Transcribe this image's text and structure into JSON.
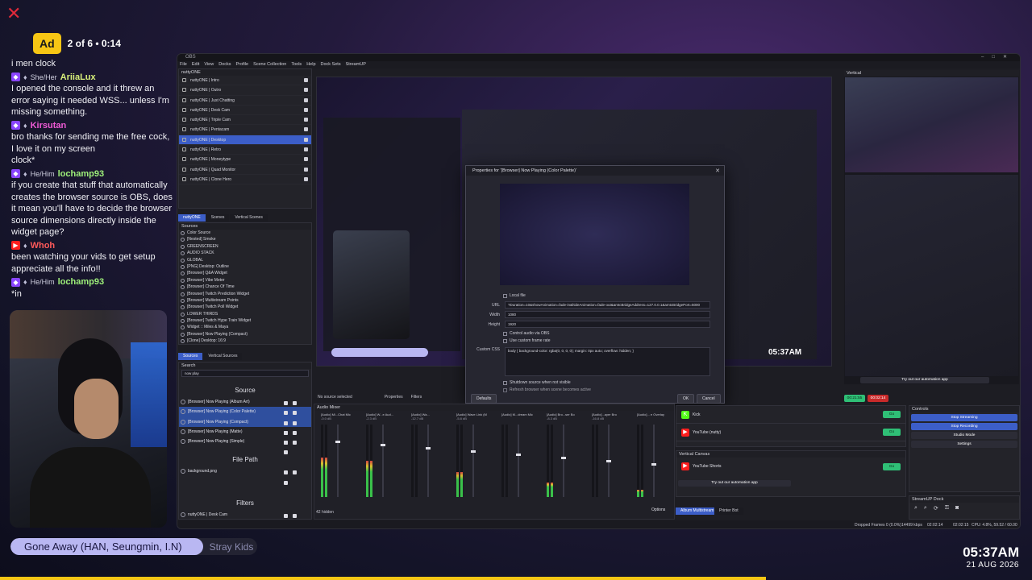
{
  "overlay": {
    "ad_label": "Ad",
    "ad_info": "2 of 6 • 0:14",
    "chat_first_line": "i men clock",
    "chat": [
      {
        "pronoun": "She/Her",
        "user": "AriiaLux",
        "cls": "u-ariia",
        "plat": "tw",
        "msg": "I opened the console and it threw an error saying it needed WSS... unless I'm missing something."
      },
      {
        "pronoun": "",
        "user": "Kirsutan",
        "cls": "u-kirsu",
        "plat": "tw",
        "msg": "bro thanks for sending me the free cock, I love it on my screen"
      },
      {
        "pronoun": "",
        "user": "",
        "cls": "",
        "plat": "",
        "msg": "clock*"
      },
      {
        "pronoun": "He/Him",
        "user": "lochamp93",
        "cls": "u-loch",
        "plat": "tw",
        "msg": "if you create that stuff that automatically creates the browser source is OBS, does it mean you'll have to decide the browser source dimensions directly inside the widget page?"
      },
      {
        "pronoun": "",
        "user": "Whoh",
        "cls": "u-whoh",
        "plat": "yt",
        "msg": "been watching your vids to get setup appreciate all the info!!"
      },
      {
        "pronoun": "He/Him",
        "user": "lochamp93",
        "cls": "u-loch",
        "plat": "tw",
        "msg": "*in"
      }
    ],
    "now_playing_title": "Gone Away (HAN, Seungmin, I.N)",
    "now_playing_artist": "Stray Kids",
    "now_playing_progress": 0.78,
    "clock_time": "05:37AM",
    "clock_date": "21 AUG 2026"
  },
  "obs": {
    "menu": [
      "File",
      "Edit",
      "View",
      "Docks",
      "Profile",
      "Scene Collection",
      "Tools",
      "Help",
      "Dock Sets",
      "StreamUP"
    ],
    "scenes_title": "nuttyONE",
    "scenes": [
      "nuttyONE | Intro",
      "nuttyONE | Outro",
      "nuttyONE | Just Chatting",
      "nuttyONE | Desk Cam",
      "nuttyONE | Triple Cam",
      "nuttyONE | Pentacam",
      "nuttyONE | Desktop",
      "nuttyONE | Retro",
      "nuttyONE | Moneytype",
      "nuttyONE | Quad Monitor",
      "nuttyONE | Clone Hero"
    ],
    "selected_scene": 6,
    "scene_tabs": [
      "nuttyONE",
      "Scenes",
      "Vertical Scenes"
    ],
    "sources_title": "Sources",
    "sources": [
      "Color Source",
      "[Nested] Smoke",
      "GREENSCREEN",
      "AUDIO STACK",
      "GLOBAL",
      "[PNG] Desktop: Outline",
      "[Browser] Q&A Widget",
      "[Browser] Vibe Meter",
      "[Browser] Chance Of Time",
      "[Browser] Twitch Prediction Widget",
      "[Browser] Multistream Points",
      "[Browser] Twitch Poll Widget",
      "LOWER THIRDS",
      "[Browser] Twitch Hype Train Widget",
      "Widget :: Miles & Maya",
      "[Browser] Now Playing (Compact)",
      "[Clone] Desktop: 16:9",
      "[Clone] Desktop: CAMERA A",
      "[Browser] Multistream Alerts",
      "[Browser] Multistream Desktop"
    ],
    "source_tabs": [
      "Sources",
      "Vertical Sources"
    ],
    "search_title": "Search",
    "search_value": "now play",
    "search_source_header": "Source",
    "search_results": [
      "[Browser] Now Playing (Album Art)",
      "[Browser] Now Playing (Color Palette)",
      "[Browser] Now Playing (Compact)",
      "[Browser] Now Playing (Matte)",
      "[Browser] Now Playing (Simple)"
    ],
    "search_selected": [
      1,
      2
    ],
    "filepath_header": "File Path",
    "filepath_results": [
      "background.png"
    ],
    "filters_header": "Filters",
    "filters_results": [
      "nuttyONE | Desk Cam"
    ],
    "hidden_count": "42 hidden",
    "no_source": "No source selected",
    "properties_btn": "Properties",
    "filters_btn": "Filters",
    "mixer_title": "Audio Mixer",
    "mixer_channels": [
      {
        "name": "[Audio] Mi...Chat Mic",
        "db": "-0.0 dB",
        "level": 0.55
      },
      {
        "name": "[Audio] W...e Aud...",
        "db": "-2.3 dB",
        "level": 0.5
      },
      {
        "name": "[Audio] Wa...",
        "db": "-12.7 dB",
        "level": 0.0
      },
      {
        "name": "[Audio] Wave Link (M",
        "db": "-5.8 dB",
        "level": 0.35
      },
      {
        "name": "[Audio] M...dream Mic",
        "db": "",
        "level": 0.0
      },
      {
        "name": "[Audio] Bro...ser Bo",
        "db": "-8.3 dB",
        "level": 0.2
      },
      {
        "name": "[Audio]...ayer Bro",
        "db": "-16.8 dB",
        "level": 0.0
      },
      {
        "name": "[Audio]... e Overlay",
        "db": "",
        "level": 0.1
      }
    ],
    "options_btn": "Options",
    "album_tab": "Album Multistream",
    "printer_tab": "Printer Bot",
    "dialog_title": "Properties for '[Browser] Now Playing (Color Palette)'",
    "dlg_local_file": "Local file",
    "dlg_url_label": "URL",
    "dlg_url_value": "?Duration=10&showAnimation=fade-in&hideAnimation=fade-out&amtcBridgeAddress=127.0.0.1&amtcBridgePort=5000",
    "dlg_width_label": "Width",
    "dlg_width_value": "1080",
    "dlg_height_label": "Height",
    "dlg_height_value": "1920",
    "dlg_control_audio": "Control audio via OBS",
    "dlg_custom_fps": "Use custom frame rate",
    "dlg_css_label": "Custom CSS",
    "dlg_css_value": "body { background-color: rgba(0, 0, 0, 0); margin: 0px auto; overflow: hidden; }",
    "dlg_shutdown": "Shutdown source when not visible",
    "dlg_refresh": "Refresh browser when scene becomes active",
    "dlg_defaults": "Defaults",
    "dlg_ok": "OK",
    "dlg_cancel": "Cancel",
    "vertical_title": "Vertical",
    "vertical_automation": "Try out our automation app",
    "vert_time": "00:21:55",
    "vert_rec": "00:02:14",
    "multistream": [
      {
        "name": "Kick",
        "btn": "Go"
      },
      {
        "name": "YouTube (nutty)",
        "btn": "Go"
      }
    ],
    "vertical_canvas_title": "Vertical Canvas",
    "vertical_canvas": [
      {
        "name": "YouTube Shorts",
        "btn": "Go"
      }
    ],
    "canvas_automation": "Try out our automation app",
    "controls_title": "Controls",
    "controls": [
      "Stop Streaming",
      "Stop Recording",
      "Studio Mode",
      "Settings"
    ],
    "streamup_title": "StreamUP Dock",
    "status": {
      "dropped": "Dropped Frames 0 (0.0%)",
      "kbps": "14499 kbps",
      "time1": "02:02:14",
      "time2": "02:02:15",
      "cpu": "CPU: 4.8%, 59.52 / 60.00 FPS"
    }
  },
  "colors": {
    "accent_blue": "#3c5ec8",
    "go_green": "#2fbf76",
    "ad_yellow": "#f7c614",
    "now_playing": "#b9b7f2"
  }
}
